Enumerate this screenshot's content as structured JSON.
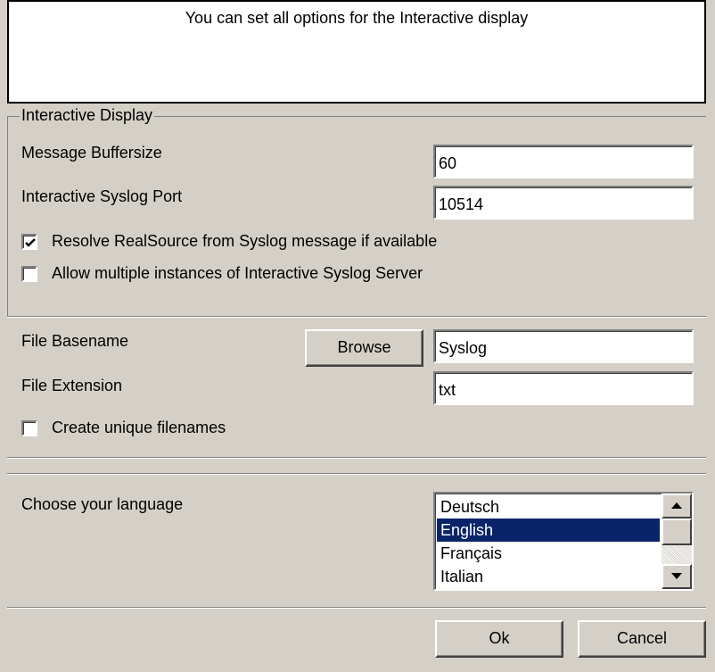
{
  "header": {
    "text": "You can set all options for the Interactive display"
  },
  "interactive_display": {
    "group_title": "Interactive Display",
    "buffersize_label": "Message Buffersize",
    "buffersize_value": "60",
    "port_label": "Interactive Syslog Port",
    "port_value": "10514",
    "resolve_label": "Resolve RealSource from Syslog message if available",
    "resolve_checked": true,
    "multiple_label": "Allow multiple instances of Interactive Syslog Server",
    "multiple_checked": false
  },
  "file": {
    "basename_label": "File Basename",
    "browse_label": "Browse",
    "basename_value": "Syslog",
    "extension_label": "File Extension",
    "extension_value": "txt",
    "unique_label": "Create unique filenames",
    "unique_checked": false
  },
  "language": {
    "label": "Choose your language",
    "options": [
      "Deutsch",
      "English",
      "Français",
      "Italian"
    ],
    "selected": "English"
  },
  "footer": {
    "ok_label": "Ok",
    "cancel_label": "Cancel"
  }
}
